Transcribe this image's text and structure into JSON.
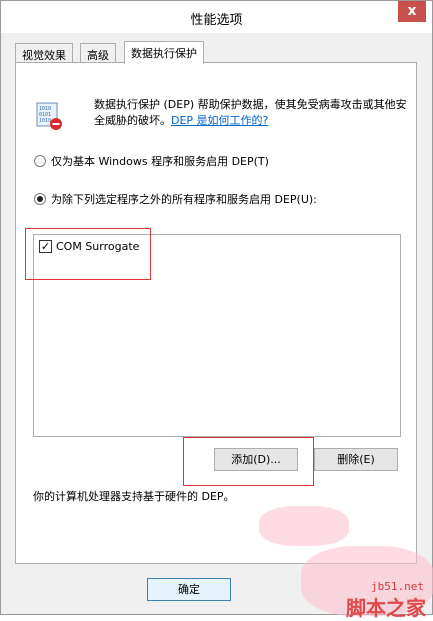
{
  "window": {
    "title": "性能选项",
    "close_glyph": "x"
  },
  "tabs": [
    {
      "label": "视觉效果"
    },
    {
      "label": "高级"
    },
    {
      "label": "数据执行保护"
    }
  ],
  "description": {
    "text": "数据执行保护 (DEP) 帮助保护数据，使其免受病毒攻击或其他安全威胁的破坏。",
    "link": "DEP 是如何工作的?"
  },
  "options": {
    "essential_only": "仅为基本 Windows 程序和服务启用 DEP(T)",
    "all_except": "为除下列选定程序之外的所有程序和服务启用 DEP(U):",
    "selected": "all_except"
  },
  "program_list": [
    {
      "label": "COM Surrogate",
      "checked": true
    }
  ],
  "buttons": {
    "add": "添加(D)...",
    "remove": "删除(E)",
    "ok": "确定"
  },
  "footer_text": "你的计算机处理器支持基于硬件的 DEP。",
  "watermark": {
    "site": "jb51.net",
    "name": "脚本之家"
  },
  "colors": {
    "annotation_red": "#e0353a",
    "close_red": "#c7504a",
    "link_blue": "#0066cc"
  }
}
